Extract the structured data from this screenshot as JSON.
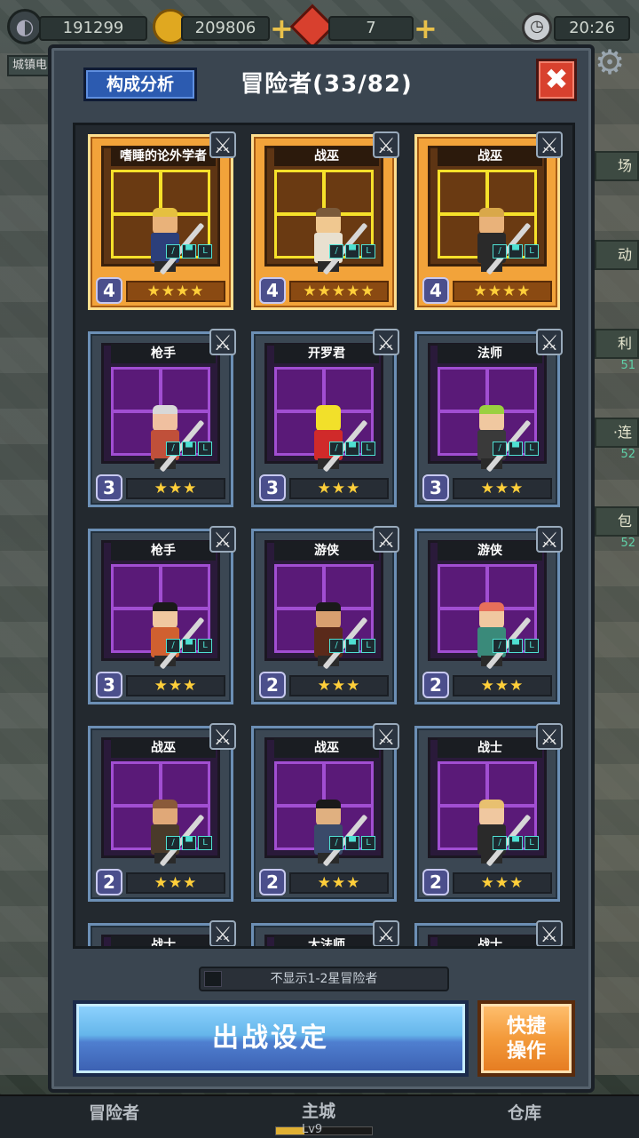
{
  "resources": {
    "power": "191299",
    "gold": "209806",
    "gems": "7",
    "time": "20:26"
  },
  "background": {
    "town_label": "城镇电",
    "right_tags": [
      {
        "label": "场"
      },
      {
        "label": "动"
      },
      {
        "label": "利",
        "sub": "51"
      },
      {
        "label": "·连",
        "sub": "52"
      },
      {
        "label": "包",
        "sub": "52"
      }
    ]
  },
  "modal": {
    "analysis_label": "构成分析",
    "title": "冒险者(33/82)",
    "close_label": "✖",
    "filter_label": "不显示1-2星冒险者",
    "deploy_label": "出战设定",
    "quick_label_line1": "快捷",
    "quick_label_line2": "操作"
  },
  "adventurers": [
    {
      "name": "嗜睡的论外学者",
      "level": "4",
      "stars": "★★★★",
      "rarity": "gold",
      "hair": "#e5c040",
      "skin": "#e9b27a",
      "outfit": "#2c3f7a"
    },
    {
      "name": "战巫",
      "level": "4",
      "stars": "★★★★★",
      "rarity": "gold",
      "hair": "#7a5a3a",
      "skin": "#f0c890",
      "outfit": "#e8e0d0"
    },
    {
      "name": "战巫",
      "level": "4",
      "stars": "★★★★",
      "rarity": "gold",
      "hair": "#d9a84a",
      "skin": "#e9b27a",
      "outfit": "#2a2a2a"
    },
    {
      "name": "枪手",
      "level": "3",
      "stars": "★★★",
      "rarity": "purple",
      "hair": "#d8d8d8",
      "skin": "#f0c0a0",
      "outfit": "#c0503a"
    },
    {
      "name": "开罗君",
      "level": "3",
      "stars": "★★★",
      "rarity": "purple",
      "hair": "#f2e02a",
      "skin": "#f2e02a",
      "outfit": "#d02a2a"
    },
    {
      "name": "法师",
      "level": "3",
      "stars": "★★★",
      "rarity": "purple",
      "hair": "#9ad040",
      "skin": "#f0c8a0",
      "outfit": "#3a3a3a"
    },
    {
      "name": "枪手",
      "level": "3",
      "stars": "★★★",
      "rarity": "purple",
      "hair": "#1a1a1a",
      "skin": "#f0c8a0",
      "outfit": "#d06030"
    },
    {
      "name": "游侠",
      "level": "2",
      "stars": "★★★",
      "rarity": "purple",
      "hair": "#1a1a1a",
      "skin": "#d8a070",
      "outfit": "#5a2a1a"
    },
    {
      "name": "游侠",
      "level": "2",
      "stars": "★★★",
      "rarity": "purple",
      "hair": "#e8705a",
      "skin": "#f0c8a0",
      "outfit": "#3a8a7a"
    },
    {
      "name": "战巫",
      "level": "2",
      "stars": "★★★",
      "rarity": "purple",
      "hair": "#8a5a3a",
      "skin": "#e0a878",
      "outfit": "#4a3a2a"
    },
    {
      "name": "战巫",
      "level": "2",
      "stars": "★★★",
      "rarity": "purple",
      "hair": "#1a1a1a",
      "skin": "#e0b080",
      "outfit": "#3a4a6a"
    },
    {
      "name": "战士",
      "level": "2",
      "stars": "★★★",
      "rarity": "purple",
      "hair": "#e8c070",
      "skin": "#f0c8a0",
      "outfit": "#2a2a2a"
    },
    {
      "name": "战士",
      "level": "",
      "stars": "",
      "rarity": "purple",
      "hair": "#333",
      "skin": "#f0c8a0",
      "outfit": "#333"
    },
    {
      "name": "大法师",
      "level": "",
      "stars": "",
      "rarity": "purple",
      "hair": "#333",
      "skin": "#f0c8a0",
      "outfit": "#333"
    },
    {
      "name": "战士",
      "level": "",
      "stars": "",
      "rarity": "purple",
      "hair": "#333",
      "skin": "#f0c8a0",
      "outfit": "#333"
    }
  ],
  "bottom_nav": {
    "adventurers": "冒险者",
    "main_city": "主城",
    "main_city_level": "Lv9",
    "main_city_progress": 0.3,
    "warehouse": "仓库"
  },
  "colors": {
    "gold_card": "#f2a33a",
    "purple_room": "#a14ed2",
    "blue_button": "#4f7fd0",
    "orange_button": "#f39a3a",
    "close_red": "#d8412e"
  }
}
